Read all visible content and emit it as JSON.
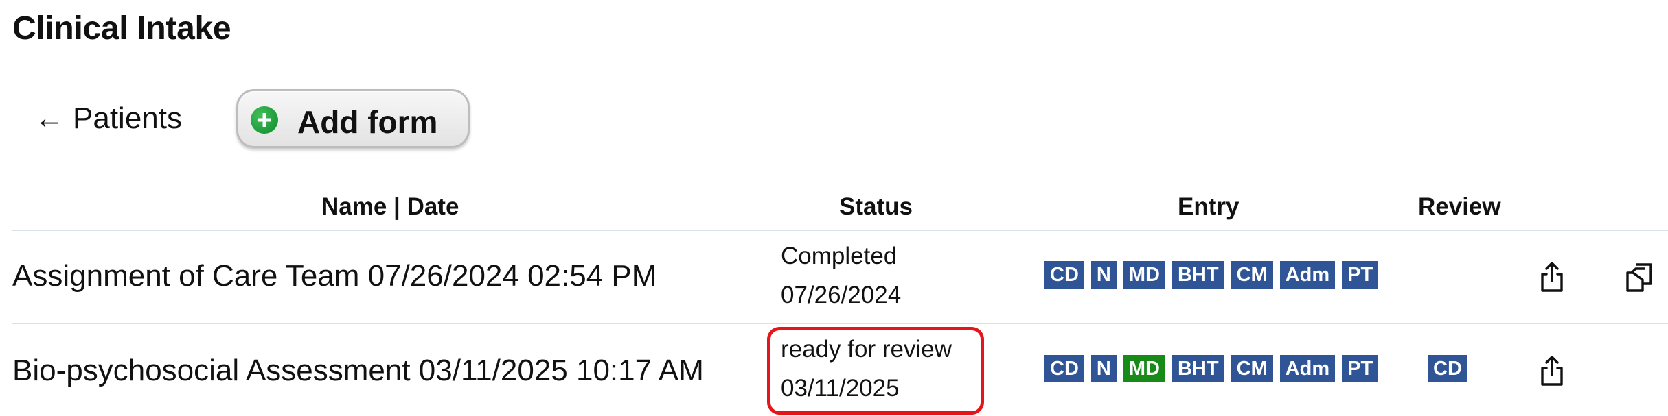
{
  "page": {
    "title": "Clinical Intake"
  },
  "toolbar": {
    "back_arrow": "←",
    "back_label": "Patients",
    "add_label": "Add form",
    "add_icon": "plus-circle-icon",
    "add_icon_color": "#1a9a37"
  },
  "table": {
    "headers": {
      "name": "Name | Date",
      "status": "Status",
      "entry": "Entry",
      "review": "Review"
    },
    "rows": [
      {
        "name": "Assignment of Care Team 07/26/2024 02:54 PM",
        "status": "Completed",
        "status_date": "07/26/2024",
        "entry": [
          "CD",
          "N",
          "MD",
          "BHT",
          "CM",
          "Adm",
          "PT"
        ],
        "review": [],
        "actions": [
          "share-icon",
          "copy-icon"
        ]
      },
      {
        "name": "Bio-psychosocial Assessment 03/11/2025 10:17 AM",
        "status": "ready for review",
        "status_date": "03/11/2025",
        "status_highlight": true,
        "entry": [
          "CD",
          "N",
          "MD",
          "BHT",
          "CM",
          "Adm",
          "PT"
        ],
        "entry_highlighted": "MD",
        "review": [
          "CD"
        ],
        "actions": [
          "share-icon"
        ]
      }
    ]
  },
  "colors": {
    "badge": "#2f5597",
    "badge_highlight": "#178a17",
    "highlight_border": "#e4161b",
    "row_divider": "#d6e3ef"
  }
}
